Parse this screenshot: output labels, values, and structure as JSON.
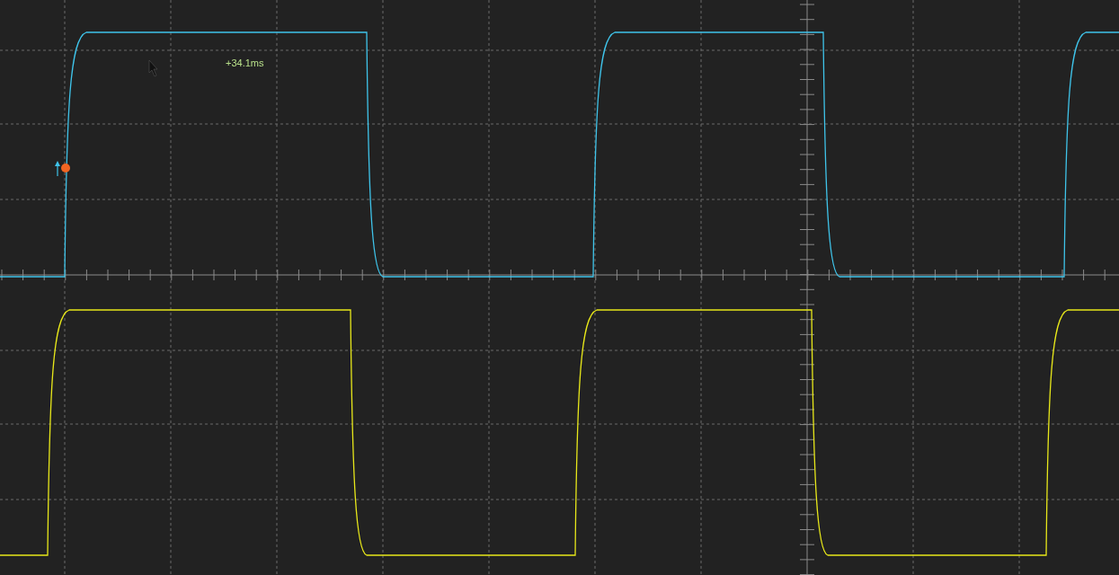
{
  "cursor_readout": {
    "text": "+34.1ms"
  }
}
